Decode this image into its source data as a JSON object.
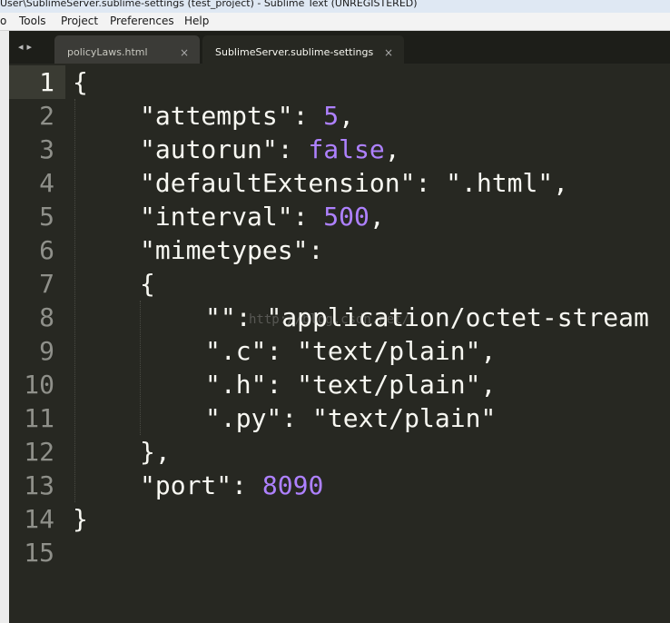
{
  "window": {
    "title": "User\\SublimeServer.sublime-settings (test_project) - Sublime Text (UNREGISTERED)"
  },
  "menu": {
    "items": [
      "o",
      "Tools",
      "Project",
      "Preferences",
      "Help"
    ]
  },
  "tabbar": {
    "nav_left": "◂",
    "nav_right": "▸",
    "tabs": [
      {
        "label": "policyLaws.html",
        "close": "×",
        "active": false
      },
      {
        "label": "SublimeServer.sublime-settings",
        "close": "×",
        "active": true
      }
    ]
  },
  "editor": {
    "current_line": 1,
    "line_numbers": [
      "1",
      "2",
      "3",
      "4",
      "5",
      "6",
      "7",
      "8",
      "9",
      "10",
      "11",
      "12",
      "13",
      "14",
      "15"
    ],
    "watermark": "http://blog.csdn.net/",
    "code": {
      "l1_open": "{",
      "l2_key": "\"attempts\"",
      "l2_colon": ": ",
      "l2_val": "5",
      "l2_comma": ",",
      "l3_key": "\"autorun\"",
      "l3_colon": ": ",
      "l3_val": "false",
      "l3_comma": ",",
      "l4_key": "\"defaultExtension\"",
      "l4_colon": ": ",
      "l4_val": "\".html\"",
      "l4_comma": ",",
      "l5_key": "\"interval\"",
      "l5_colon": ": ",
      "l5_val": "500",
      "l5_comma": ",",
      "l6_key": "\"mimetypes\"",
      "l6_colon": ":",
      "l7_open": "{",
      "l8_key": "\"\"",
      "l8_colon": ": ",
      "l8_val": "\"application/octet-stream",
      "l9_key": "\".c\"",
      "l9_colon": ": ",
      "l9_val": "\"text/plain\"",
      "l9_comma": ",",
      "l10_key": "\".h\"",
      "l10_colon": ": ",
      "l10_val": "\"text/plain\"",
      "l10_comma": ",",
      "l11_key": "\".py\"",
      "l11_colon": ": ",
      "l11_val": "\"text/plain\"",
      "l12_close": "},",
      "l13_key": "\"port\"",
      "l13_colon": ": ",
      "l13_val": "8090",
      "l14_close": "}"
    }
  }
}
